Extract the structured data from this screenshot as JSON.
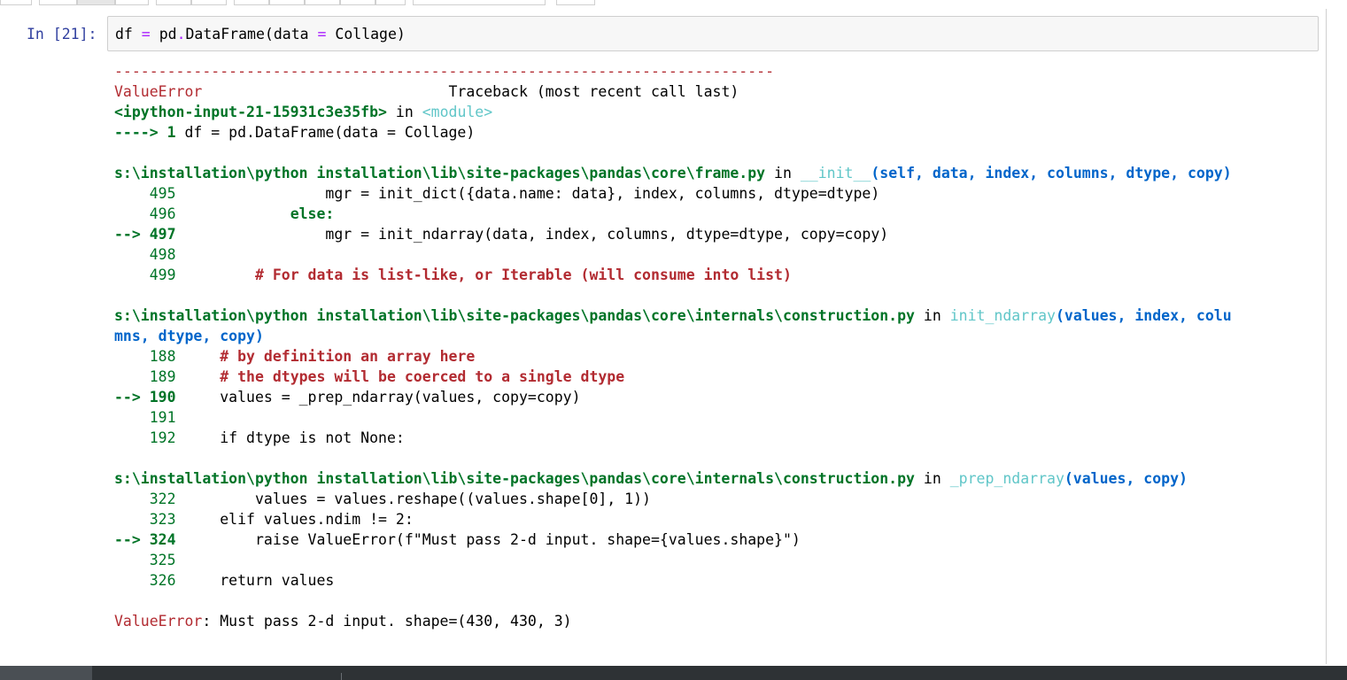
{
  "cell": {
    "prompt": "In [21]:",
    "code": {
      "var": "df",
      "eq": " = ",
      "obj": "pd",
      "dot": ".",
      "func": "DataFrame",
      "args_open": "(data ",
      "args_eq": "=",
      "args_close": " Collage)"
    }
  },
  "traceback": {
    "dashes": "---------------------------------------------------------------------------",
    "error_name": "ValueError",
    "tb_header": "                            Traceback (most recent call last)",
    "input_ref": "<ipython-input-21-15931c3e35fb>",
    "in_word": " in ",
    "module": "<module>",
    "line1_arrow": "----> 1 ",
    "line1_code": "df = pd.DataFrame(data = Collage)",
    "frames": [
      {
        "path": "s:\\installation\\python installation\\lib\\site-packages\\pandas\\core\\frame.py",
        "func": "__init__",
        "sig": "(self, data, index, columns, dtype, copy)",
        "lines": [
          {
            "gutter": "    495 ",
            "code": "                mgr = init_dict({data.name: data}, index, columns, dtype=dtype)"
          },
          {
            "gutter": "    496 ",
            "code": "            else:"
          },
          {
            "gutter": "--> 497 ",
            "code": "                mgr = init_ndarray(data, index, columns, dtype=dtype, copy=copy)"
          },
          {
            "gutter": "    498 ",
            "code": ""
          },
          {
            "gutter": "    499 ",
            "code": "        # For data is list-like, or Iterable (will consume into list)"
          }
        ]
      },
      {
        "path": "s:\\installation\\python installation\\lib\\site-packages\\pandas\\core\\internals\\construction.py",
        "func": "init_ndarray",
        "sig_part1": "(values, index, colu",
        "sig_part2": "mns, dtype, copy)",
        "lines": [
          {
            "gutter": "    188 ",
            "code": "    # by definition an array here"
          },
          {
            "gutter": "    189 ",
            "code": "    # the dtypes will be coerced to a single dtype"
          },
          {
            "gutter": "--> 190 ",
            "code": "    values = _prep_ndarray(values, copy=copy)"
          },
          {
            "gutter": "    191 ",
            "code": ""
          },
          {
            "gutter": "    192 ",
            "code": "    if dtype is not None:"
          }
        ]
      },
      {
        "path": "s:\\installation\\python installation\\lib\\site-packages\\pandas\\core\\internals\\construction.py",
        "func": "_prep_ndarray",
        "sig": "(values, copy)",
        "lines": [
          {
            "gutter": "    322 ",
            "code": "        values = values.reshape((values.shape[0], 1))"
          },
          {
            "gutter": "    323 ",
            "code": "    elif values.ndim != 2:"
          },
          {
            "gutter": "--> 324 ",
            "code": "        raise ValueError(f\"Must pass 2-d input. shape={values.shape}\")"
          },
          {
            "gutter": "    325 ",
            "code": ""
          },
          {
            "gutter": "    326 ",
            "code": "    return values"
          }
        ]
      }
    ],
    "final_error_name": "ValueError",
    "final_error_msg": ": Must pass 2-d input. shape=(430, 430, 3)"
  }
}
